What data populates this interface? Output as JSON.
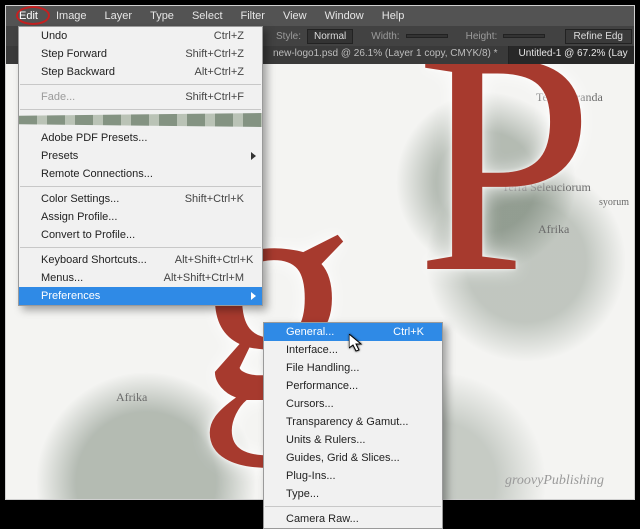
{
  "menubar": [
    "Edit",
    "Image",
    "Layer",
    "Type",
    "Select",
    "Filter",
    "View",
    "Window",
    "Help"
  ],
  "options_bar": {
    "style_label": "Style:",
    "style_value": "Normal",
    "width_label": "Width:",
    "height_label": "Height:",
    "refine_button": "Refine Edg"
  },
  "tabs": [
    {
      "title": "new-logo1.psd @ 26.1% (Layer 1 copy, CMYK/8) *",
      "active": false
    },
    {
      "title": "Untitled-1 @ 67.2% (Lay",
      "active": true
    }
  ],
  "edit_menu": {
    "main": [
      {
        "label": "Undo",
        "shortcut": "Ctrl+Z"
      },
      {
        "label": "Step Forward",
        "shortcut": "Shift+Ctrl+Z"
      },
      {
        "label": "Step Backward",
        "shortcut": "Alt+Ctrl+Z"
      }
    ],
    "fade": {
      "label": "Fade...",
      "shortcut": "Shift+Ctrl+F"
    },
    "presets": [
      {
        "label": "Adobe PDF Presets..."
      },
      {
        "label": "Presets",
        "submenu": true
      },
      {
        "label": "Remote Connections..."
      }
    ],
    "color": [
      {
        "label": "Color Settings...",
        "shortcut": "Shift+Ctrl+K"
      },
      {
        "label": "Assign Profile..."
      },
      {
        "label": "Convert to Profile..."
      }
    ],
    "shortcuts": [
      {
        "label": "Keyboard Shortcuts...",
        "shortcut": "Alt+Shift+Ctrl+K"
      },
      {
        "label": "Menus...",
        "shortcut": "Alt+Shift+Ctrl+M"
      }
    ],
    "prefs": {
      "label": "Preferences",
      "submenu": true,
      "highlight": true
    }
  },
  "prefs_menu": {
    "general": {
      "label": "General...",
      "shortcut": "Ctrl+K",
      "highlight": true
    },
    "rest": [
      "Interface...",
      "File Handling...",
      "Performance...",
      "Cursors...",
      "Transparency & Gamut...",
      "Units & Rulers...",
      "Guides, Grid & Slices...",
      "Plug-Ins...",
      "Type..."
    ],
    "camera": "Camera Raw..."
  },
  "map_labels": {
    "afrika1": "Afrika",
    "terra_paranda": "Terra\nParanda",
    "terra_seleuciorum": "Terra\nSeleuciorum",
    "afrika2": "Afrika",
    "syorum": "syorum"
  },
  "watermark": "groovyPublishing"
}
